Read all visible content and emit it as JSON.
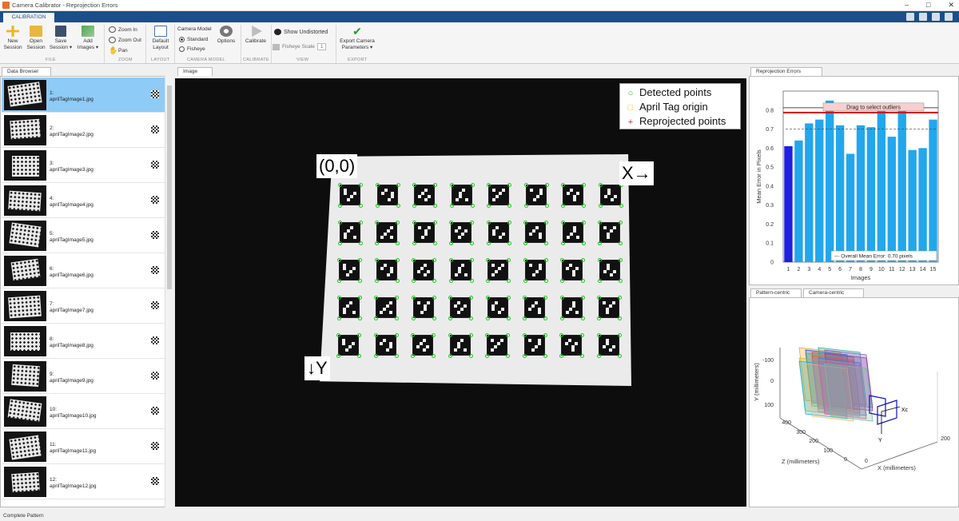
{
  "window": {
    "title": "Camera Calibrator - Reprojection Errors"
  },
  "tabs": {
    "calibration": "CALIBRATION"
  },
  "ribbon": {
    "new_session": "New\nSession",
    "open_session": "Open\nSession",
    "save_session": "Save\nSession ▾",
    "add_images": "Add\nImages ▾",
    "zoom_in": "Zoom In",
    "zoom_out": "Zoom Out",
    "pan": "Pan",
    "default_layout": "Default\nLayout",
    "camera_model": "Camera Model",
    "standard": "Standard",
    "fisheye": "Fisheye",
    "options": "Options",
    "calibrate": "Calibrate",
    "show_undistorted": "Show Undistorted",
    "fisheye_scale": "Fisheye Scale",
    "fisheye_scale_value": "1",
    "export": "Export Camera\nParameters ▾",
    "groups": {
      "file": "FILE",
      "zoom": "ZOOM",
      "layout": "LAYOUT",
      "camera_model": "CAMERA MODEL",
      "calibrate": "CALIBRATE",
      "view": "VIEW",
      "export": "EXPORT"
    }
  },
  "panels": {
    "data_browser": "Data Browser",
    "image": "Image",
    "reprojection": "Reprojection Errors",
    "pattern_centric": "Pattern-centric",
    "camera_centric": "Camera-centric"
  },
  "browser_items": [
    {
      "num": "1:",
      "file": "aprilTagImage1.jpg"
    },
    {
      "num": "2:",
      "file": "aprilTagImage2.jpg"
    },
    {
      "num": "3:",
      "file": "aprilTagImage3.jpg"
    },
    {
      "num": "4:",
      "file": "aprilTagImage4.jpg"
    },
    {
      "num": "5:",
      "file": "aprilTagImage5.jpg"
    },
    {
      "num": "6:",
      "file": "aprilTagImage6.jpg"
    },
    {
      "num": "7:",
      "file": "aprilTagImage7.jpg"
    },
    {
      "num": "8:",
      "file": "aprilTagImage8.jpg"
    },
    {
      "num": "9:",
      "file": "aprilTagImage9.jpg"
    },
    {
      "num": "10:",
      "file": "aprilTagImage10.jpg"
    },
    {
      "num": "11:",
      "file": "aprilTagImage11.jpg"
    },
    {
      "num": "12:",
      "file": "aprilTagImage12.jpg"
    }
  ],
  "image_view": {
    "legend": {
      "detected": "Detected points",
      "origin": "April Tag origin",
      "reprojected": "Reprojected points"
    },
    "origin_label": "(0,0)",
    "x_label": "X→",
    "y_label": "↓Y"
  },
  "chart_data": [
    {
      "type": "bar",
      "categories": [
        "1",
        "2",
        "3",
        "4",
        "5",
        "6",
        "7",
        "8",
        "9",
        "10",
        "11",
        "12",
        "13",
        "14",
        "15"
      ],
      "values": [
        0.61,
        0.64,
        0.73,
        0.75,
        0.85,
        0.72,
        0.57,
        0.72,
        0.71,
        0.81,
        0.66,
        0.8,
        0.59,
        0.6,
        0.75
      ],
      "xlabel": "Images",
      "ylabel": "Mean Error in Pixels",
      "ylim": [
        0,
        0.9
      ],
      "yticks": [
        "0",
        "0.1",
        "0.2",
        "0.3",
        "0.4",
        "0.5",
        "0.6",
        "0.7",
        "0.8"
      ],
      "threshold": 0.85,
      "threshold_label": "Drag to select outliers",
      "mean": 0.7,
      "mean_label": "Overall Mean Error: 0.70 pixels",
      "colors": {
        "bar": "#22a7ec",
        "selected": "#1f1fe0",
        "threshold": "#d11010"
      }
    },
    {
      "type": "scatter",
      "xlabel": "X (millimeters)",
      "ylabel": "Y (millimeters)",
      "zlabel": "Z (millimeters)",
      "yticks": [
        "-100",
        "0",
        "100"
      ],
      "zticks": [
        "400",
        "300",
        "200",
        "100",
        "0"
      ],
      "xticks": [
        "200",
        "0"
      ],
      "axis_x": "Xc",
      "axis_y": "Y"
    }
  ],
  "status": "Complete Pattern"
}
